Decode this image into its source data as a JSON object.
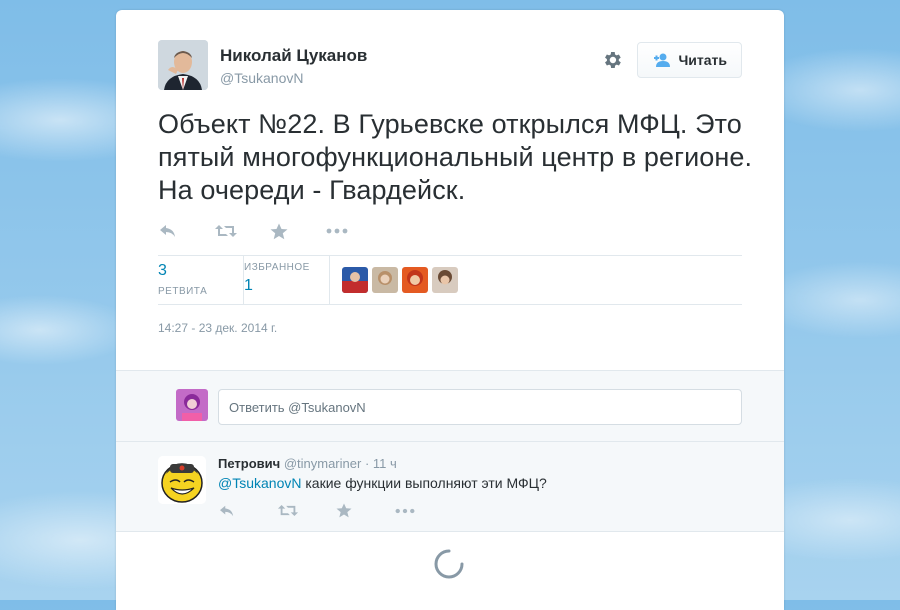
{
  "author": {
    "fullname": "Николай Цуканов",
    "username": "@TsukanovN"
  },
  "follow_button": {
    "label": "Читать"
  },
  "tweet": {
    "text": "Объект №22. В Гурьевске открылся МФЦ. Это пятый многофункциональный центр в регионе. На очереди - Гвардейск.",
    "timestamp": "14:27 - 23 дек. 2014 г."
  },
  "stats": {
    "retweets_count": "3",
    "retweets_label": "РЕТВИТА",
    "favorites_label": "ИЗБРАННОЕ",
    "favorites_count": "1"
  },
  "reply_box": {
    "placeholder": "Ответить @TsukanovN"
  },
  "reply": {
    "name": "Петрович",
    "username": "@tinymariner",
    "separator": "·",
    "time": "11 ч",
    "mention": "@TsukanovN",
    "text": " какие функции выполняют эти МФЦ?"
  },
  "icons": {
    "reply": "reply-icon",
    "retweet": "retweet-icon",
    "favorite": "star-icon",
    "more": "more-icon",
    "settings": "gear-icon",
    "follow": "add-user-icon",
    "loading": "spinner-icon"
  },
  "colors": {
    "link": "#0084b4",
    "text": "#292f33",
    "muted": "#8899a6",
    "icon": "#aab8c2"
  }
}
